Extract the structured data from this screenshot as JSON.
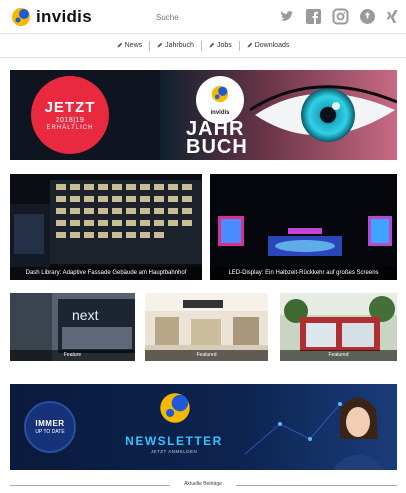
{
  "header": {
    "logo_text": "invidis",
    "search_placeholder": "Suche"
  },
  "nav": {
    "items": [
      {
        "label": "News"
      },
      {
        "label": "Jahrbuch"
      },
      {
        "label": "Jobs"
      },
      {
        "label": "Downloads"
      }
    ]
  },
  "hero": {
    "badge_line1": "JETZT",
    "badge_line2": "2018|19",
    "badge_line3": "ERHÄLTLICH",
    "logo_text": "invidis",
    "title_line1": "JAHR",
    "title_line2": "BUCH"
  },
  "articles": [
    {
      "caption": "Dash Library: Adaptive Fassade Gebäude am Hauptbahnhof"
    },
    {
      "caption": "LED-Display: Ein Halbzeit-Rückkehr auf großes Screens"
    },
    {
      "caption": "Feature"
    },
    {
      "caption": "Featured"
    },
    {
      "caption": "Featured"
    }
  ],
  "newsletter": {
    "badge_line1": "IMMER",
    "badge_line2": "UP TO DATE",
    "title": "NEWSLETTER",
    "subtitle": "JETZT ANMELDEN"
  },
  "footer": {
    "section_label": "Aktuelle Beiträge"
  },
  "colors": {
    "brand_blue": "#1e5ad7",
    "brand_yellow": "#f5b800",
    "badge_red": "#e8293f",
    "newsletter_cyan": "#36c2ff"
  }
}
